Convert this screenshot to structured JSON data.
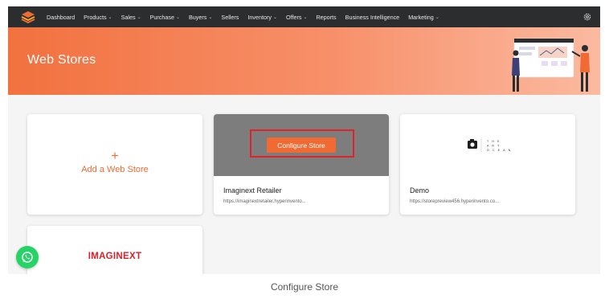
{
  "nav": {
    "items": [
      {
        "label": "Dashboard",
        "dropdown": false
      },
      {
        "label": "Products",
        "dropdown": true
      },
      {
        "label": "Sales",
        "dropdown": true
      },
      {
        "label": "Purchase",
        "dropdown": true
      },
      {
        "label": "Buyers",
        "dropdown": true
      },
      {
        "label": "Sellers",
        "dropdown": false
      },
      {
        "label": "Inventory",
        "dropdown": true
      },
      {
        "label": "Offers",
        "dropdown": true
      },
      {
        "label": "Reports",
        "dropdown": false
      },
      {
        "label": "Business Intelligence",
        "dropdown": false
      },
      {
        "label": "Marketing",
        "dropdown": true
      }
    ],
    "chevron": "⌄",
    "settings_icon": "gear-icon"
  },
  "hero": {
    "title": "Web Stores",
    "illustration": "people-with-dashboard-illustration"
  },
  "cards": {
    "add": {
      "plus": "+",
      "label": "Add a Web Store"
    },
    "retailer": {
      "button_label": "Configure Store",
      "name": "Imaginext Retailer",
      "url": "https://imaginextretailer.hyperinvento..."
    },
    "demo": {
      "logo": "the-art-ocean-logo",
      "logo_text": "THE ART OCEAN",
      "name": "Demo",
      "url": "https://storepreview456.hyperinvento.co..."
    },
    "imaginext": {
      "logo_text": "IMAGINEXT"
    }
  },
  "whatsapp_icon": "whatsapp-icon",
  "caption": "Configure Store",
  "colors": {
    "accent": "#f06b33",
    "nav_bg": "#2b2d2f",
    "highlight": "#e2222a",
    "whatsapp": "#25d366"
  }
}
